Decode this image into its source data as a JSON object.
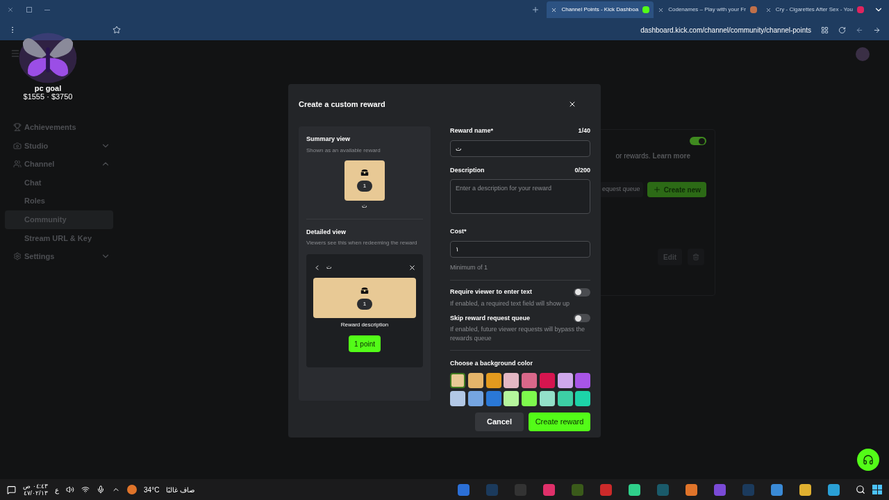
{
  "browser": {
    "tabs": [
      {
        "title": "Channel Points - Kick Dashboa",
        "selected": true,
        "color": "#53fc18"
      },
      {
        "title": "Codenames – Play with your Fr",
        "selected": false,
        "color": "#c0704a"
      },
      {
        "title": "Cry - Cigarettes After Sex - You",
        "selected": false,
        "color": "#e0245e"
      }
    ],
    "url": "dashboard.kick.com/channel/community/channel-points"
  },
  "goal_widget": {
    "title": "pc goal",
    "amount": "$1555 · $3750"
  },
  "sidebar": {
    "items": [
      {
        "label": "Achievements",
        "kind": "link",
        "selected": false
      },
      {
        "label": "Studio",
        "kind": "group",
        "expanded": false,
        "selected": false
      },
      {
        "label": "Channel",
        "kind": "group",
        "expanded": true,
        "selected": false,
        "children": [
          {
            "label": "Chat",
            "kind": "sub",
            "selected": false
          },
          {
            "label": "Roles",
            "kind": "sub",
            "selected": false
          },
          {
            "label": "Community",
            "kind": "sub",
            "selected": true
          },
          {
            "label": "Stream URL & Key",
            "kind": "sub",
            "selected": false
          }
        ]
      },
      {
        "label": "Settings",
        "kind": "group",
        "expanded": false,
        "selected": false
      }
    ]
  },
  "background": {
    "rewards_on": true,
    "text": "or rewards.",
    "link": "Learn more",
    "queue_button": "equest queue",
    "create_button": "Create new",
    "edit_button": "Edit"
  },
  "modal": {
    "title": "Create a custom reward",
    "summary": {
      "heading": "Summary view",
      "subtext": "Shown as an available reward",
      "count": "1",
      "name": "ت"
    },
    "detailed": {
      "heading": "Detailed view",
      "subtext": "Viewers see this when redeeming the reward",
      "name": "ت",
      "count": "1",
      "description": "Reward description",
      "button": "1 point"
    },
    "name_field": {
      "label": "Reward name*",
      "counter": "1/40",
      "value": "ت"
    },
    "description_field": {
      "label": "Description",
      "counter": "0/200",
      "placeholder": "Enter a description for your reward"
    },
    "cost_field": {
      "label": "Cost*",
      "value": "١",
      "hint": "Minimum of 1"
    },
    "options": [
      {
        "label": "Require viewer to enter text",
        "hint": "If enabled, a required text field will show up",
        "on": false
      },
      {
        "label": "Skip reward request queue",
        "hint": "If enabled, future viewer requests will bypass the rewards queue",
        "on": false
      }
    ],
    "color_label": "Choose a background color",
    "colors": [
      {
        "color": "#e8c995",
        "selected": true
      },
      {
        "color": "#e5b56a",
        "selected": false
      },
      {
        "color": "#e39a1e",
        "selected": false
      },
      {
        "color": "#e3b7c4",
        "selected": false
      },
      {
        "color": "#d9688a",
        "selected": false
      },
      {
        "color": "#d6154f",
        "selected": false
      },
      {
        "color": "#d0a8ec",
        "selected": false
      },
      {
        "color": "#a855e6",
        "selected": false
      },
      {
        "color": "#b2c8e6",
        "selected": false
      },
      {
        "color": "#75a5e0",
        "selected": false
      },
      {
        "color": "#2a78d6",
        "selected": false
      },
      {
        "color": "#b5f59c",
        "selected": false
      },
      {
        "color": "#7ef94d",
        "selected": false
      },
      {
        "color": "#93e0c9",
        "selected": false
      },
      {
        "color": "#3dcfa5",
        "selected": false
      },
      {
        "color": "#1dd3a8",
        "selected": false
      }
    ],
    "cancel_button": "Cancel",
    "create_button": "Create reward"
  },
  "taskbar": {
    "time": "٠٤:٤٣ ص",
    "date": "٤٧/٠٢/١٣",
    "language": "ع",
    "temperature": "34°C",
    "weather": "صاف غالبًا",
    "apps": [
      {
        "color": "#2b6fd6"
      },
      {
        "color": "#1b3a5c"
      },
      {
        "color": "#333333"
      },
      {
        "color": "#e0306a"
      },
      {
        "color": "#3a5a1a"
      },
      {
        "color": "#cc2a2a"
      },
      {
        "color": "#2fcf8a"
      },
      {
        "color": "#1a5a6a"
      },
      {
        "color": "#e0742a"
      },
      {
        "color": "#7a4ad6"
      },
      {
        "color": "#1b3a5c"
      },
      {
        "color": "#3a8ad6"
      },
      {
        "color": "#e0b030"
      },
      {
        "color": "#2aa0d6"
      }
    ]
  }
}
